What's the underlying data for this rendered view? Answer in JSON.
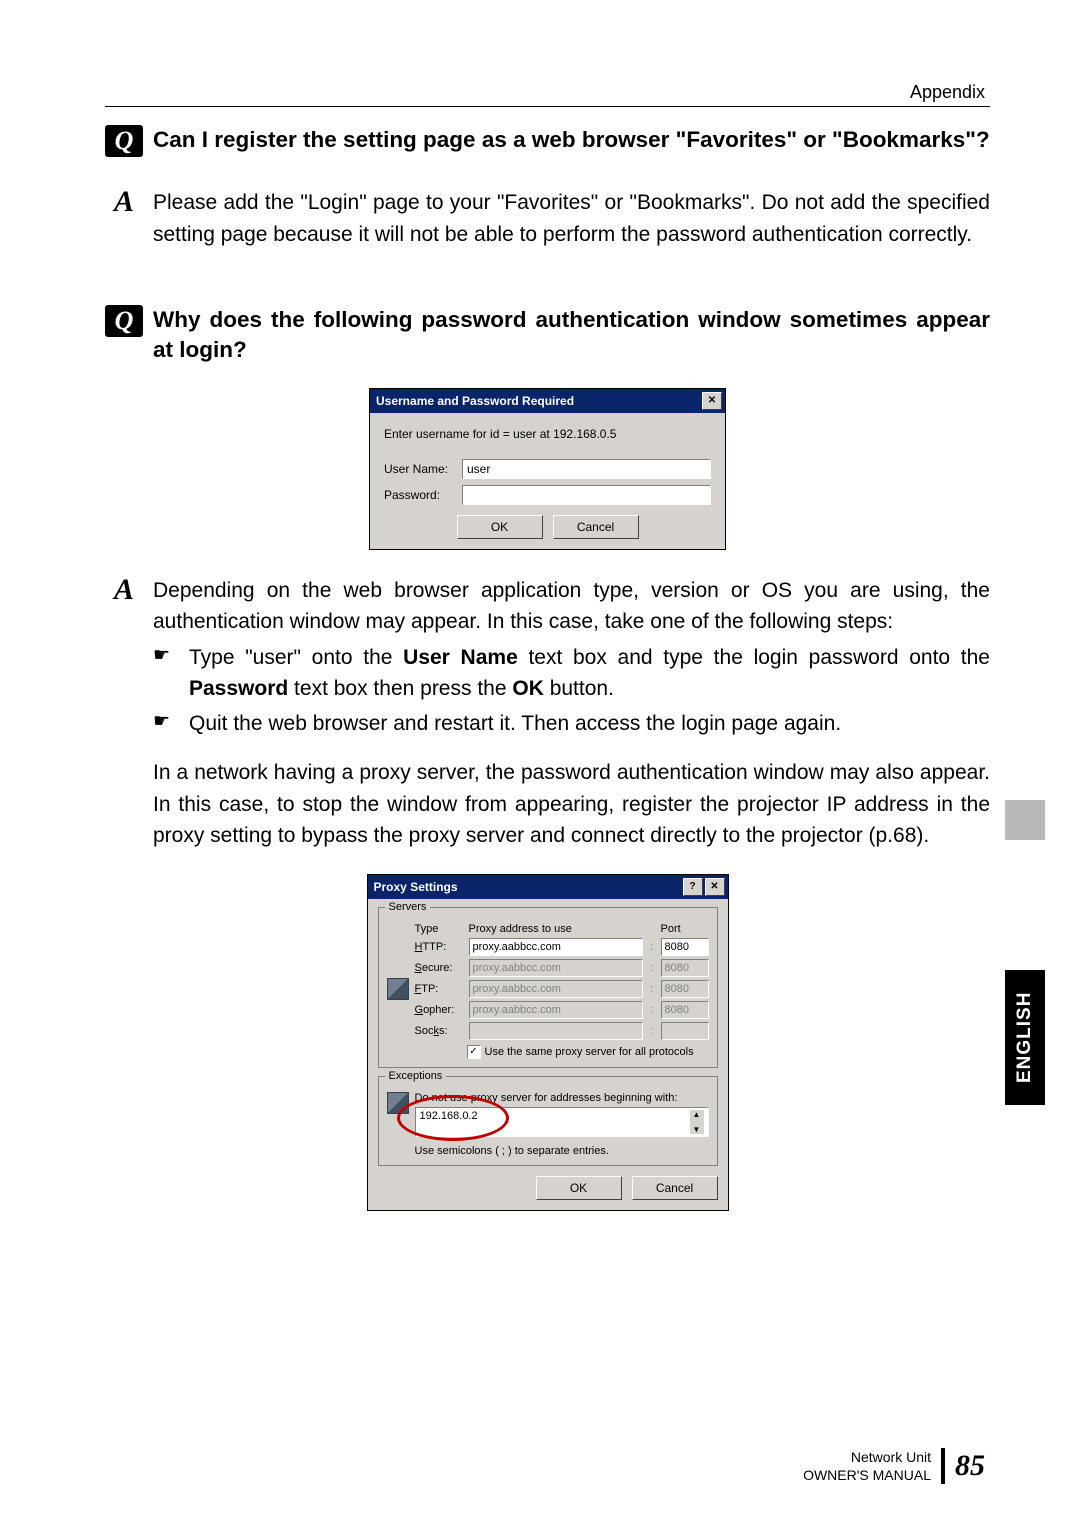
{
  "header": {
    "section": "Appendix"
  },
  "qa1": {
    "q_label": "Q",
    "question": "Can I register the setting page as a web browser \"Favorites\" or \"Bookmarks\"?",
    "a_label": "A",
    "answer": "Please add the \"Login\" page to your \"Favorites\" or \"Bookmarks\". Do not add the specified setting page because it will not be able to perform the password authentication correctly."
  },
  "qa2": {
    "q_label": "Q",
    "question": "Why does the following password authentication window sometimes appear at login?",
    "a_label": "A",
    "answer_intro": "Depending on the web browser application type, version or OS you are using, the authentication window may appear. In this case, take one of the following steps:",
    "bullets": [
      {
        "pre": "Type \"user\" onto the ",
        "b1": "User Name",
        "mid": " text box and type the login password onto the ",
        "b2": "Password",
        "mid2": " text box then press the ",
        "b3": "OK",
        "post": " button."
      },
      {
        "plain": "Quit the web browser and restart it. Then access the login page again."
      }
    ],
    "para2": "In a network having a proxy server, the password authentication window may also appear. In this case, to stop the window from appearing, register the projector IP address in the proxy setting to bypass the proxy server and connect directly to the projector (p.68)."
  },
  "auth_dialog": {
    "title": "Username and Password Required",
    "message": "Enter username for id = user at 192.168.0.5",
    "username_label": "User Name:",
    "username_value": "user",
    "password_label": "Password:",
    "ok": "OK",
    "cancel": "Cancel"
  },
  "proxy_dialog": {
    "title": "Proxy Settings",
    "servers": {
      "legend": "Servers",
      "type": "Type",
      "addr": "Proxy address to use",
      "port": "Port",
      "rows": [
        {
          "label": "HTTP:",
          "addr": "proxy.aabbcc.com",
          "port": "8080",
          "enabled": true
        },
        {
          "label": "Secure:",
          "addr": "proxy.aabbcc.com",
          "port": "8080",
          "enabled": false
        },
        {
          "label": "FTP:",
          "addr": "proxy.aabbcc.com",
          "port": "8080",
          "enabled": false
        },
        {
          "label": "Gopher:",
          "addr": "proxy.aabbcc.com",
          "port": "8080",
          "enabled": false
        },
        {
          "label": "Socks:",
          "addr": "",
          "port": "",
          "enabled": false
        }
      ],
      "same_proxy": "Use the same proxy server for all protocols"
    },
    "exceptions": {
      "legend": "Exceptions",
      "hint_top": "Do not use proxy server for addresses beginning with:",
      "value": "192.168.0.2",
      "hint_bottom": "Use semicolons ( ; ) to separate entries."
    },
    "ok": "OK",
    "cancel": "Cancel"
  },
  "side_tab": "ENGLISH",
  "footer": {
    "line1": "Network Unit",
    "line2": "OWNER'S MANUAL",
    "page": "85"
  }
}
